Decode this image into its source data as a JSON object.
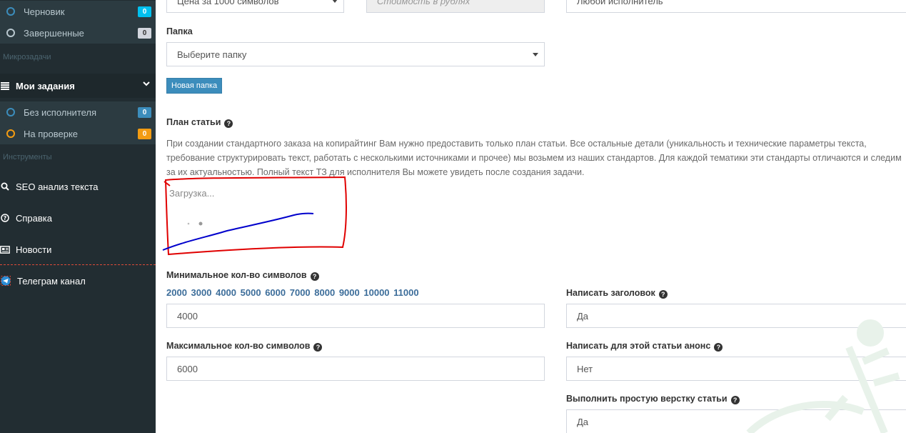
{
  "sidebar": {
    "top_items": [
      {
        "label": "Черновик",
        "badge": "0",
        "badge_color": "#00c0ef"
      },
      {
        "label": "Завершенные",
        "badge": "0",
        "badge_color": "#d2d6de"
      }
    ],
    "section_micro": "Микрозадачи",
    "my_tasks": {
      "label": "Мои задания"
    },
    "task_items": [
      {
        "label": "Без исполнителя",
        "badge": "0",
        "badge_color": "#3c8dbc"
      },
      {
        "label": "На проверке",
        "badge": "0",
        "badge_color": "#f39c12"
      }
    ],
    "section_tools": "Инструменты",
    "tools": [
      {
        "label": "SEO анализ текста",
        "icon": "search-icon"
      },
      {
        "label": "Справка",
        "icon": "question-circle-icon"
      },
      {
        "label": "Новости",
        "icon": "newspaper-icon"
      },
      {
        "label": "Телеграм канал",
        "icon": "telegram-icon"
      }
    ]
  },
  "form": {
    "price_type": "Цена за 1000 символов",
    "cost_placeholder": "Стоимость в рублях",
    "performer": "Любой исполнитель",
    "folder_label": "Папка",
    "folder_value": "Выберите папку",
    "new_folder_button": "Новая папка",
    "plan_label": "План статьи",
    "plan_description": "При создании стандартного заказа на копирайтинг Вам нужно предоставить только план статьи. Все остальные детали (уникальность и технические параметры текста, требование структурировать текст, работать с несколькими источниками и прочее) мы возьмем из наших стандартов. Для каждой тематики эти стандарты отличаются и следим за их актуальностью. Полный текст ТЗ для исполнителя Вы можете увидеть после создания задачи.",
    "loading_text": "Загрузка...",
    "min_chars_label": "Минимальное кол-во символов",
    "char_presets": [
      "2000",
      "3000",
      "4000",
      "5000",
      "6000",
      "7000",
      "8000",
      "9000",
      "10000",
      "11000"
    ],
    "min_chars_value": "4000",
    "max_chars_label": "Максимальное кол-во символов",
    "max_chars_value": "6000",
    "write_title_label": "Написать заголовок",
    "write_title_value": "Да",
    "write_announce_label": "Написать для этой статьи анонс",
    "write_announce_value": "Нет",
    "layout_label": "Выполнить простую верстку статьи",
    "layout_value": "Да"
  },
  "colors": {
    "sidebar_bg": "#222d32",
    "accent": "#3c8dbc",
    "annotation_red": "#e00000",
    "annotation_blue": "#0000cc"
  }
}
